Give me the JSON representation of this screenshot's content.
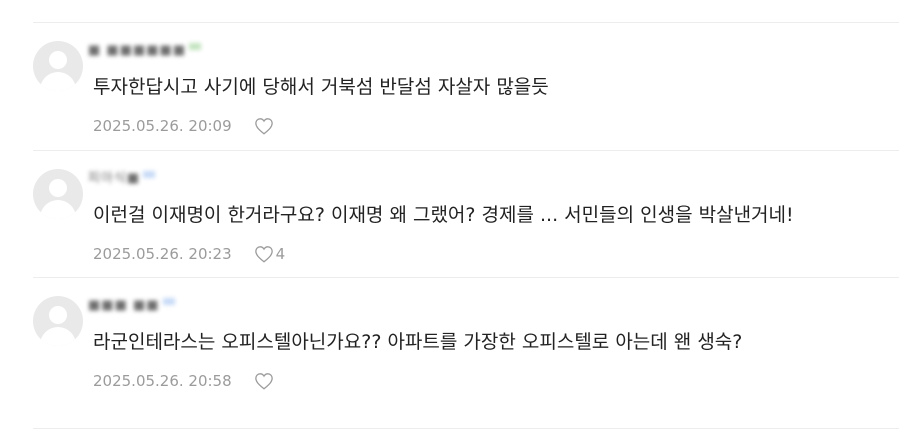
{
  "colors": {
    "nick_badge_green": "#b7dfb3",
    "nick_badge_blue": "#bcd3f5",
    "divider": "#ededed",
    "meta_text": "#9b9b9b"
  },
  "icons": {
    "avatar": "default-user-avatar-icon",
    "like": "heart-outline-icon"
  },
  "comments": [
    {
      "nickname": "■ ■■■■■■",
      "text": "투자한답시고 사기에 당해서 거북섬 반달섬 자살자 많을듯",
      "date": "2025.05.26. 20:09",
      "like_count": ""
    },
    {
      "nickname": "피아식■",
      "text": "이런걸 이재명이 한거라구요? 이재명 왜 그랬어? 경제를 ... 서민들의 인생을 박살낸거네!",
      "date": "2025.05.26. 20:23",
      "like_count": "4"
    },
    {
      "nickname": "■■■ ■■",
      "text": "라군인테라스는 오피스텔아닌가요?? 아파트를 가장한 오피스텔로 아는데 왠 생숙?",
      "date": "2025.05.26. 20:58",
      "like_count": ""
    }
  ]
}
